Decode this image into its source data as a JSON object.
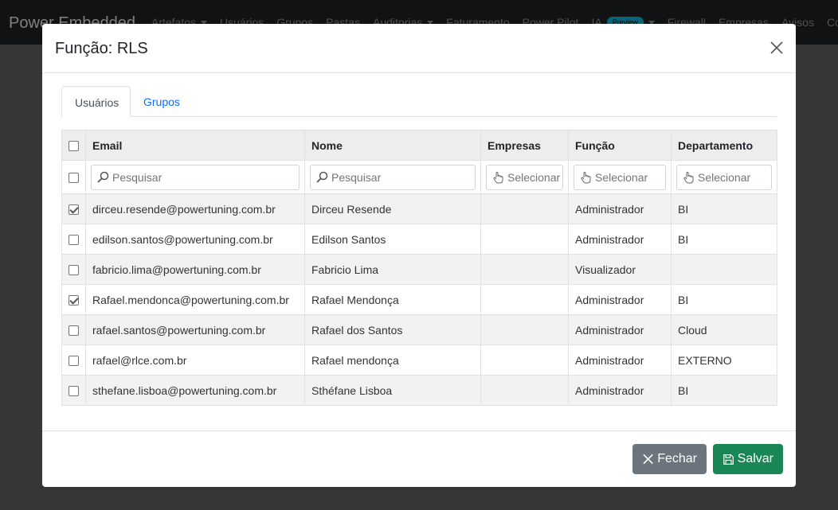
{
  "navbar": {
    "brand": "Power Embedded",
    "items": [
      "Artefatos",
      "Usuários",
      "Grupos",
      "Pastas",
      "Auditorias",
      "Faturamento",
      "Power Pilot",
      "IA",
      "Firewall",
      "Empresas",
      "Avisos",
      "Co"
    ],
    "preview_badge": "Preview"
  },
  "modal": {
    "title": "Função: RLS",
    "tabs": [
      {
        "label": "Usuários"
      },
      {
        "label": "Grupos"
      }
    ],
    "table": {
      "headers": {
        "email": "Email",
        "nome": "Nome",
        "empresas": "Empresas",
        "funcao": "Função",
        "departamento": "Departamento"
      },
      "filters": {
        "email": "Pesquisar",
        "nome": "Pesquisar",
        "empresas": "Selecionar",
        "funcao": "Selecionar",
        "departamento": "Selecionar"
      },
      "rows": [
        {
          "checked": true,
          "email": "dirceu.resende@powertuning.com.br",
          "nome": "Dirceu Resende",
          "empresas": "",
          "funcao": "Administrador",
          "departamento": "BI"
        },
        {
          "checked": false,
          "email": "edilson.santos@powertuning.com.br",
          "nome": "Edilson Santos",
          "empresas": "",
          "funcao": "Administrador",
          "departamento": "BI"
        },
        {
          "checked": false,
          "email": "fabricio.lima@powertuning.com.br",
          "nome": "Fabricio Lima",
          "empresas": "",
          "funcao": "Visualizador",
          "departamento": ""
        },
        {
          "checked": true,
          "email": "Rafael.mendonca@powertuning.com.br",
          "nome": "Rafael Mendonça",
          "empresas": "",
          "funcao": "Administrador",
          "departamento": "BI"
        },
        {
          "checked": false,
          "email": "rafael.santos@powertuning.com.br",
          "nome": "Rafael dos Santos",
          "empresas": "",
          "funcao": "Administrador",
          "departamento": "Cloud"
        },
        {
          "checked": false,
          "email": "rafael@rlce.com.br",
          "nome": "Rafael mendonça",
          "empresas": "",
          "funcao": "Administrador",
          "departamento": "EXTERNO"
        },
        {
          "checked": false,
          "email": "sthefane.lisboa@powertuning.com.br",
          "nome": "Sthéfane Lisboa",
          "empresas": "",
          "funcao": "Administrador",
          "departamento": "BI"
        }
      ]
    },
    "footer": {
      "close_label": "Fechar",
      "save_label": "Salvar"
    },
    "colors": {
      "primary": "#0d6efd",
      "secondary": "#6c757d",
      "success": "#198754"
    }
  }
}
